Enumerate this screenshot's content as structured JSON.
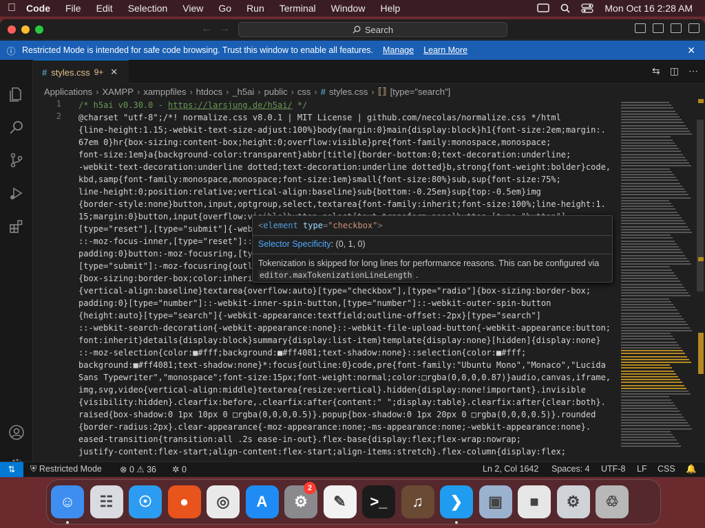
{
  "menubar": {
    "app": "Code",
    "items": [
      "File",
      "Edit",
      "Selection",
      "View",
      "Go",
      "Run",
      "Terminal",
      "Window",
      "Help"
    ],
    "clock": "Mon Oct 16  2:28 AM"
  },
  "titlebar": {
    "search_label": "Search"
  },
  "banner": {
    "message": "Restricted Mode is intended for safe code browsing. Trust this window to enable all features.",
    "manage": "Manage",
    "learn_more": "Learn More"
  },
  "tab": {
    "filename": "styles.css",
    "problems": "9+"
  },
  "breadcrumb": [
    "Applications",
    "XAMPP",
    "xamppfiles",
    "htdocs",
    "_h5ai",
    "public",
    "css",
    "styles.css",
    "[type=\"search\"]"
  ],
  "editor": {
    "line_numbers": [
      "1",
      "2"
    ],
    "line1_comment": "/* h5ai v0.30.0 - ",
    "line1_link": "https://larsjung.de/h5ai/",
    "line1_end": " */",
    "lines": [
      "@charset \"utf-8\";/*! normalize.css v8.0.1 | MIT License | github.com/necolas/normalize.css */html",
      "{line-height:1.15;-webkit-text-size-adjust:100%}body{margin:0}main{display:block}h1{font-size:2em;margin:.",
      "67em 0}hr{box-sizing:content-box;height:0;overflow:visible}pre{font-family:monospace,monospace;",
      "font-size:1em}a{background-color:transparent}abbr[title]{border-bottom:0;text-decoration:underline;",
      "-webkit-text-decoration:underline dotted;text-decoration:underline dotted}b,strong{font-weight:bolder}code,",
      "kbd,samp{font-family:monospace,monospace;font-size:1em}small{font-size:80%}sub,sup{font-size:75%;",
      "line-height:0;position:relative;vertical-align:baseline}sub{bottom:-0.25em}sup{top:-0.5em}img",
      "{border-style:none}button,input,optgroup,select,textarea{font-family:inherit;font-size:100%;line-height:1.",
      "15;margin:0}button,input{overflow:visible}button,select{text-transform:none}button,[type=\"button\"],",
      "[type=\"reset\"],[type=\"submit\"]{-webk",
      "::-moz-focus-inner,[type=\"reset\"]::",
      "padding:0}button:-moz-focusring,[ty",
      "[type=\"submit\"]:-moz-focusring{outl",
      "{box-sizing:border-box;color:inheri",
      "{vertical-align:baseline}textarea{overflow:auto}[type=\"checkbox\"],[type=\"radio\"]{box-sizing:border-box;",
      "padding:0}[type=\"number\"]::-webkit-inner-spin-button,[type=\"number\"]::-webkit-outer-spin-button",
      "{height:auto}[type=\"search\"]{-webkit-appearance:textfield;outline-offset:-2px}[type=\"search\"]",
      "::-webkit-search-decoration{-webkit-appearance:none}::-webkit-file-upload-button{-webkit-appearance:button;",
      "font:inherit}details{display:block}summary{display:list-item}template{display:none}[hidden]{display:none}",
      "::-moz-selection{color:■#fff;background:■#ff4081;text-shadow:none}::selection{color:■#fff;",
      "background:■#ff4081;text-shadow:none}*:focus{outline:0}code,pre{font-family:\"Ubuntu Mono\",\"Monaco\",\"Lucida",
      "Sans Typewriter\",\"monospace\";font-size:15px;font-weight:normal;color:□rgba(0,0,0,0.87)}audio,canvas,iframe,",
      "img,svg,video{vertical-align:middle}textarea{resize:vertical}.hidden{display:none!important}.invisible",
      "{visibility:hidden}.clearfix:before,.clearfix:after{content:\" \";display:table}.clearfix:after{clear:both}.",
      "raised{box-shadow:0 1px 10px 0 □rgba(0,0,0,0.5)}.popup{box-shadow:0 1px 20px 0 □rgba(0,0,0,0.5)}.rounded",
      "{border-radius:2px}.clear-appearance{-moz-appearance:none;-ms-appearance:none;-webkit-appearance:none}.",
      "eased-transition{transition:all .2s ease-in-out}.flex-base{display:flex;flex-wrap:nowrap;",
      "justify-content:flex-start;align-content:flex-start;align-items:stretch}.flex-column{display:flex;"
    ]
  },
  "hover": {
    "element_tag": "element",
    "attr_name": "type",
    "attr_value": "\"checkbox\"",
    "spec_label": "Selector Specificity",
    "spec_value": ": (0, 1, 0)",
    "note": "Tokenization is skipped for long lines for performance reasons. This can be configured via",
    "setting": "editor.maxTokenizationLineLength",
    "note_end": "."
  },
  "statusbar": {
    "restricted": "Restricted Mode",
    "errors": "0",
    "warnings": "36",
    "ports": "0",
    "position": "Ln 2, Col 1642",
    "spaces": "Spaces: 4",
    "encoding": "UTF-8",
    "eol": "LF",
    "language": "CSS"
  },
  "dock": {
    "badge_count": "2",
    "apps": [
      {
        "name": "finder",
        "color": "#3d8ef0"
      },
      {
        "name": "launchpad",
        "color": "#d9dbe0"
      },
      {
        "name": "safari",
        "color": "#2c9cf2"
      },
      {
        "name": "firefox",
        "color": "#e8541c"
      },
      {
        "name": "chrome",
        "color": "#e9e9e9"
      },
      {
        "name": "app-store",
        "color": "#1f8cf5"
      },
      {
        "name": "system-settings",
        "color": "#8a8a8e"
      },
      {
        "name": "textedit",
        "color": "#f2f2f2"
      },
      {
        "name": "terminal",
        "color": "#1b1b1b"
      },
      {
        "name": "garageband",
        "color": "#6a4a33"
      },
      {
        "name": "vscode",
        "color": "#1f9cf0"
      },
      {
        "name": "virtualbox",
        "color": "#9bb2cf"
      },
      {
        "name": "roblox",
        "color": "#e6e6e6"
      },
      {
        "name": "settings-utility",
        "color": "#cfd3d8"
      },
      {
        "name": "trash",
        "color": "#b8b8b8"
      }
    ]
  }
}
